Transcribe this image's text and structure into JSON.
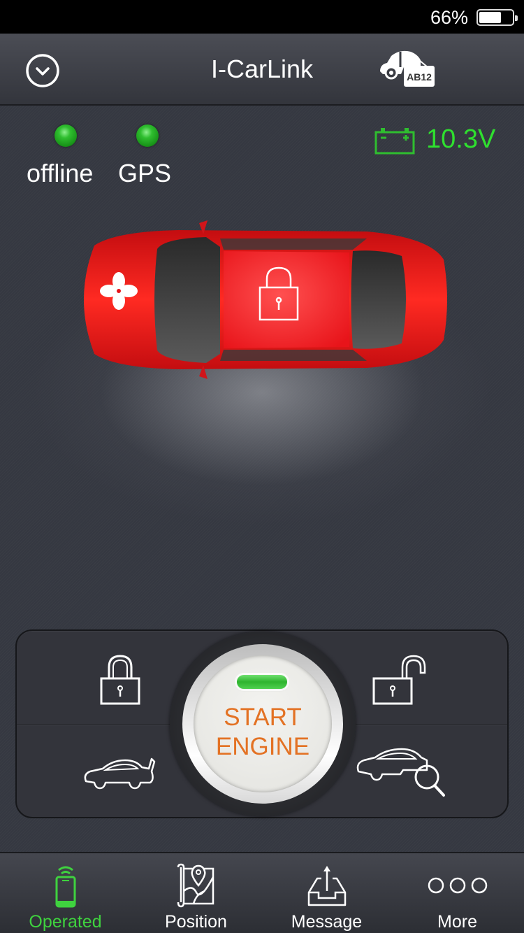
{
  "status_bar": {
    "battery_percent": "66%",
    "battery_level": 0.66
  },
  "header": {
    "title": "I-CarLink",
    "left_icon": "chevron-down-circle-icon",
    "right_icon": "car-plate-icon",
    "plate_text": "AB12"
  },
  "status": {
    "indicators": [
      {
        "label": "offline",
        "color": "#2fbe2f"
      },
      {
        "label": "GPS",
        "color": "#2fbe2f"
      }
    ],
    "voltage": "10.3V",
    "voltage_color": "#2fe02f"
  },
  "car": {
    "color": "#e8141a",
    "hood_icon": "fan-icon",
    "roof_icon": "lock-icon",
    "lock_state": "locked"
  },
  "controls": {
    "lock": {
      "icon": "lock-icon"
    },
    "unlock": {
      "icon": "unlock-icon"
    },
    "trunk": {
      "icon": "car-trunk-icon"
    },
    "find_car": {
      "icon": "car-search-icon"
    },
    "engine": {
      "line1": "START",
      "line2": "ENGINE",
      "led_color": "#2eb42e",
      "text_color": "#e37224"
    }
  },
  "tabbar": {
    "active_color": "#3fd23f",
    "tabs": [
      {
        "label": "Operated",
        "icon": "phone-remote-icon",
        "active": true
      },
      {
        "label": "Position",
        "icon": "map-pin-icon",
        "active": false
      },
      {
        "label": "Message",
        "icon": "inbox-upload-icon",
        "active": false
      },
      {
        "label": "More",
        "icon": "more-dots-icon",
        "active": false
      }
    ]
  }
}
